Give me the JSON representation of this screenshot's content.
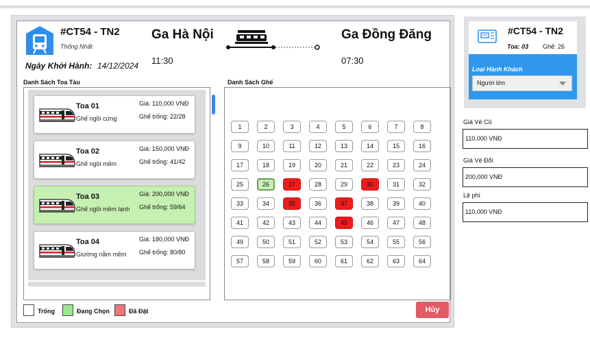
{
  "trip": {
    "code": "#CT54 - TN2",
    "name": "Thống Nhất",
    "from_station": "Ga Hà Nội",
    "to_station": "Ga Đồng Đăng",
    "depart_time": "11:30",
    "arrive_time": "07:30",
    "date_label": "Ngày Khởi Hành:",
    "date_value": "14/12/2024"
  },
  "sections": {
    "coach_list_title": "Danh Sách Toa Tàu",
    "seat_list_title": "Danh Sách Ghế"
  },
  "coaches": [
    {
      "name": "Toa 01",
      "type": "Ghế ngồi cứng",
      "price": "Giá: 110,000 VNĐ",
      "free": "Ghế trống: 22/28",
      "selected": false
    },
    {
      "name": "Toa 02",
      "type": "Ghế ngồi mềm",
      "price": "Giá: 150,000 VNĐ",
      "free": "Ghế trống: 41/42",
      "selected": false
    },
    {
      "name": "Toa 03",
      "type": "Ghế ngồi mềm lạnh",
      "price": "Giá: 200,000 VNĐ",
      "free": "Ghế trống: 59/64",
      "selected": true
    },
    {
      "name": "Toa 04",
      "type": "Giường nằm mềm",
      "price": "Giá: 180,000 VNĐ",
      "free": "Ghế trống: 80/80",
      "selected": false
    }
  ],
  "seats": {
    "count": 64,
    "chosen": [
      26
    ],
    "booked": [
      27,
      30,
      35,
      37,
      45
    ]
  },
  "legend": {
    "empty": "Trống",
    "selecting": "Đang Chọn",
    "booked": "Đã Đặt"
  },
  "actions": {
    "cancel": "Hủy"
  },
  "ticket": {
    "code": "#CT54 - TN2",
    "coach": "Toa: 03",
    "seat": "Ghế: 26",
    "passenger_type_label": "Loại Hành Khách",
    "passenger_type_value": "Người lớn"
  },
  "pricing": {
    "old_label": "Giá Vé Cũ",
    "old_value": "110,000 VNĐ",
    "new_label": "Giá Vé Đổi",
    "new_value": "200,000 VNĐ",
    "fee_label": "Lệ phí",
    "fee_value": "110,000 VNĐ"
  },
  "colors": {
    "accent_blue": "#2f98ee",
    "selected_green": "#c5f0b2",
    "booked_red": "#ef1c1c",
    "cancel_red": "#e25b66"
  }
}
